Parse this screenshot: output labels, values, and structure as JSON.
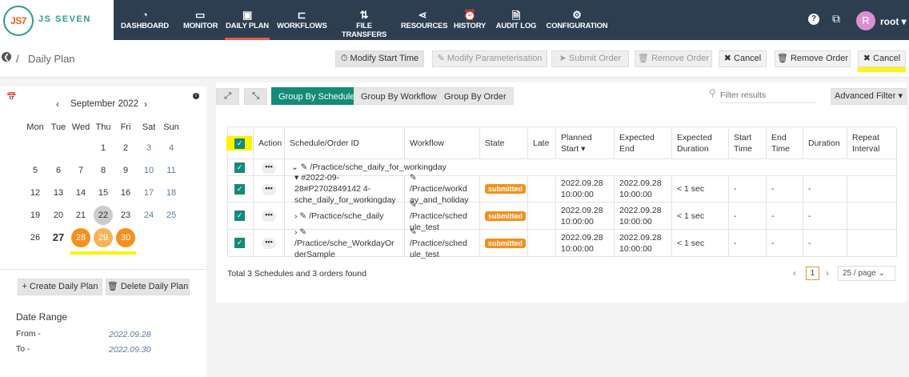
{
  "brand": {
    "name": "JS SEVEN",
    "mark": "JS7"
  },
  "nav": [
    {
      "label": "DASHBOARD",
      "icon": "dashboard-icon",
      "glyph": "◔"
    },
    {
      "label": "MONITOR",
      "icon": "monitor-icon",
      "glyph": "▭"
    },
    {
      "label": "DAILY PLAN",
      "icon": "calendar-clock-icon",
      "glyph": "▣",
      "active": true
    },
    {
      "label": "WORKFLOWS",
      "icon": "workflow-icon",
      "glyph": "⊏"
    },
    {
      "label": "FILE TRANSFERS",
      "icon": "transfer-icon",
      "glyph": "⇅"
    },
    {
      "label": "RESOURCES",
      "icon": "share-icon",
      "glyph": "⋖"
    },
    {
      "label": "HISTORY",
      "icon": "alarm-clock-icon",
      "glyph": "⏰"
    },
    {
      "label": "AUDIT LOG",
      "icon": "audit-icon",
      "glyph": "🗎"
    },
    {
      "label": "CONFIGURATION",
      "icon": "gears-icon",
      "glyph": "⚙"
    }
  ],
  "user": {
    "initial": "R",
    "name": "root ▾"
  },
  "breadcrumb": {
    "sep": "/",
    "title": "Daily Plan"
  },
  "toolbar": [
    {
      "label": "⏱ Modify Start Time",
      "disabled": false
    },
    {
      "label": "✎ Modify Parameterisation",
      "disabled": true
    },
    {
      "label": "➤ Submit Order",
      "disabled": true
    },
    {
      "label": "🗑 Remove Order",
      "disabled": true
    },
    {
      "label": "✖ Cancel",
      "disabled": false
    },
    {
      "label": "🗑 Remove Order",
      "disabled": false
    },
    {
      "label": "✖ Cancel",
      "disabled": false
    }
  ],
  "calendar": {
    "month": "September 2022",
    "weekdays": [
      "Mon",
      "Tue",
      "Wed",
      "Thu",
      "Fri",
      "Sat",
      "Sun"
    ],
    "weeks": [
      [
        "",
        "",
        "",
        "1",
        "2",
        "3",
        "4"
      ],
      [
        "5",
        "6",
        "7",
        "8",
        "9",
        "10",
        "11"
      ],
      [
        "12",
        "13",
        "14",
        "15",
        "16",
        "17",
        "18"
      ],
      [
        "19",
        "20",
        "21",
        "22",
        "23",
        "24",
        "25"
      ],
      [
        "26",
        "27",
        "28",
        "29",
        "30",
        "",
        ""
      ]
    ],
    "today": "27",
    "selected": [
      "28",
      "29",
      "30"
    ],
    "grey": "22"
  },
  "left_actions": {
    "create": "+ Create Daily Plan",
    "delete": "🗑 Delete Daily Plan"
  },
  "date_range": {
    "title": "Date Range",
    "from_label": "From -",
    "from": "2022.09.28",
    "to_label": "To -",
    "to": "2022.09.30"
  },
  "group_by": [
    "Group By Schedule",
    "Group By Workflow",
    "Group By Order"
  ],
  "filter": {
    "placeholder": "Filter results",
    "advanced": "Advanced Filter ▾"
  },
  "table": {
    "headers": [
      "",
      "Action",
      "Schedule/Order ID",
      "Workflow",
      "State",
      "Late",
      "Planned Start ▾",
      "Expected End",
      "Expected Duration",
      "Start Time",
      "End Time",
      "Duration",
      "Repeat Interval"
    ],
    "group_row": "⌄ ✎ /Practice/sche_daily_for_workingday",
    "rows": [
      {
        "id": "▾ #2022-09-28#P2702849142 4-sche_daily_for_workingday",
        "workflow": "✎ /Practice/workd ay_and_holiday",
        "state": "submitted",
        "late": "",
        "planned": "2022.09.28 10:00:00",
        "end": "2022.09.28 10:00:00",
        "duration_exp": "< 1 sec",
        "start": "-",
        "endt": "-",
        "dur": "-",
        "repeat": ""
      },
      {
        "id": "› ✎ /Practice/sche_daily",
        "workflow": "✎ /Practice/sched ule_test",
        "state": "submitted",
        "late": "",
        "planned": "2022.09.28 10:00:00",
        "end": "2022.09.28 10:00:00",
        "duration_exp": "< 1 sec",
        "start": "-",
        "endt": "-",
        "dur": "-",
        "repeat": ""
      },
      {
        "id": "› ✎ /Practice/sche_WorkdayOr derSample",
        "workflow": "✎ /Practice/sched ule_test",
        "state": "submitted",
        "late": "",
        "planned": "2022.09.28 10:00:00",
        "end": "2022.09.28 10:00:00",
        "duration_exp": "< 1 sec",
        "start": "-",
        "endt": "-",
        "dur": "-",
        "repeat": ""
      }
    ]
  },
  "footer": {
    "summary": "Total 3 Schedules and 3 orders found",
    "page": "1",
    "per_page": "25 / page ⌄"
  },
  "colors": {
    "header": "#2c3e50",
    "accent": "#148a7a",
    "badge": "#f5901e",
    "highlight": "#fff200"
  }
}
